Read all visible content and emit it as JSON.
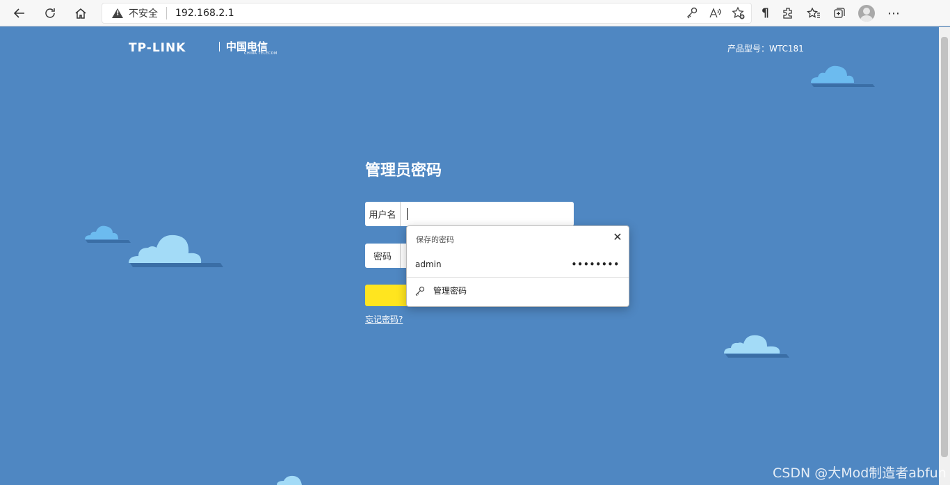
{
  "browser": {
    "security_label": "不安全",
    "url": "192.168.2.1"
  },
  "header": {
    "brand_tplink": "TP-LINK",
    "brand_telecom": "中国电信",
    "brand_telecom_sub": "CHINA TELECOM",
    "product_model": "产品型号：WTC181"
  },
  "login": {
    "title": "管理员密码",
    "username_label": "用户名",
    "password_label": "密码",
    "forgot_link": "忘记密码?"
  },
  "password_popup": {
    "header": "保存的密码",
    "saved_user": "admin",
    "saved_password_mask": "••••••••",
    "manage_label": "管理密码"
  },
  "watermark": "CSDN @大Mod制造者abfun"
}
